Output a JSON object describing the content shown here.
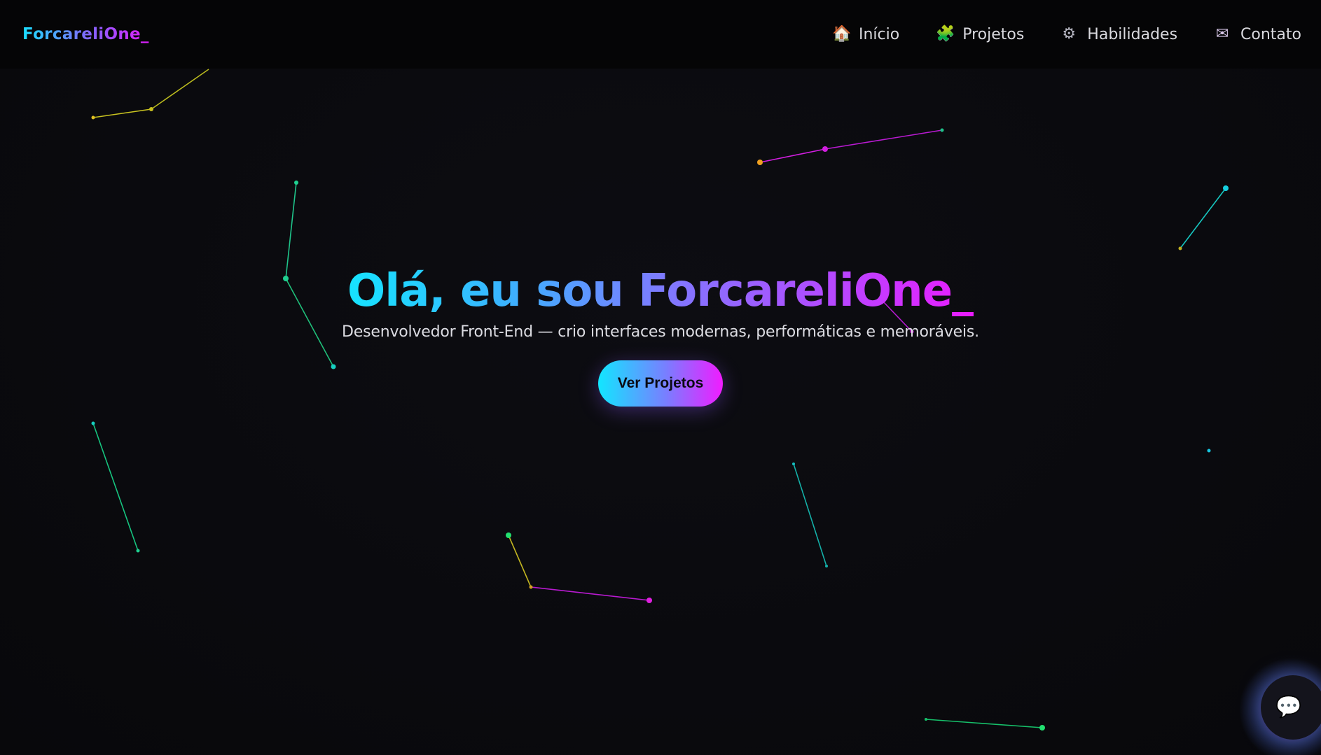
{
  "brand": {
    "logo_text": "ForcareliOne_"
  },
  "nav": {
    "items": [
      {
        "icon": "home-icon",
        "glyph": "🏠",
        "label": "Início"
      },
      {
        "icon": "puzzle-icon",
        "glyph": "🧩",
        "label": "Projetos"
      },
      {
        "icon": "gear-icon",
        "glyph": "⚙",
        "label": "Habilidades"
      },
      {
        "icon": "mail-icon",
        "glyph": "✉",
        "label": "Contato"
      }
    ]
  },
  "hero": {
    "title": "Olá, eu sou ForcareliOne_",
    "subtitle": "Desenvolvedor Front-End — crio interfaces modernas, performáticas e memoráveis.",
    "cta_label": "Ver Projetos"
  },
  "chat": {
    "icon": "chat-bubble-icon",
    "glyph": "💬"
  },
  "colors": {
    "background": "#0a0a0d",
    "accent_cyan": "#16e4ff",
    "accent_purple": "#7d7bff",
    "accent_magenta": "#ea1bff"
  }
}
